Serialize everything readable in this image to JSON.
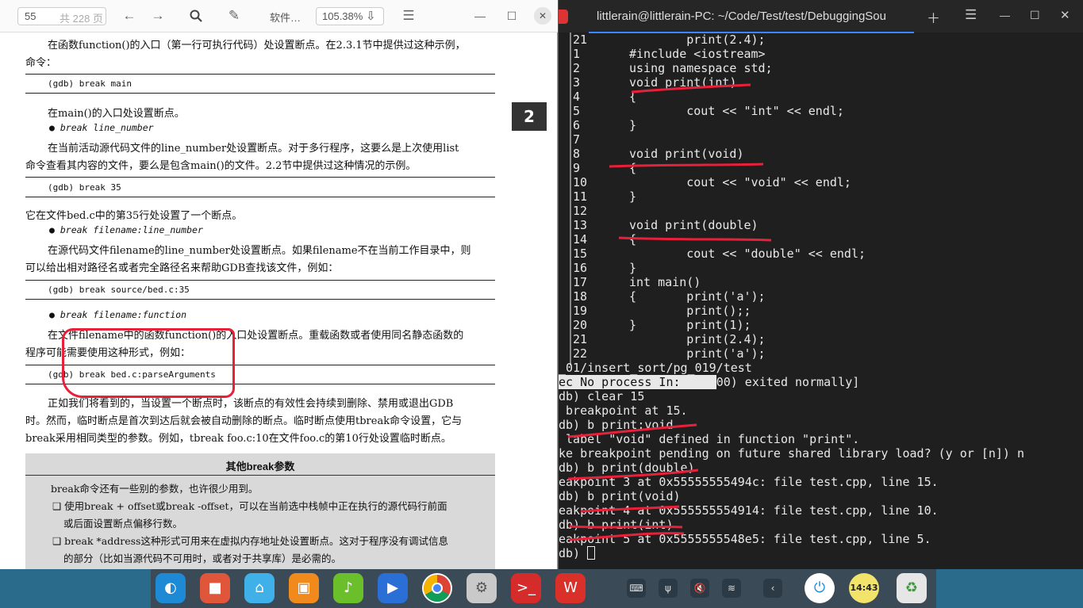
{
  "pdf": {
    "toolbar": {
      "page": "55",
      "total": "共 228 页",
      "title": "软件…",
      "zoom": "105.38%"
    },
    "chapter_tab": "2",
    "lines": [
      "在函数function()的入口（第一行可执行代码）处设置断点。在2.3.1节中提供过这种示例，",
      "命令：",
      "(gdb) break main",
      "在main()的入口处设置断点。",
      "break line_number",
      "在当前活动源代码文件的line_number处设置断点。对于多行程序，这要么是上次使用list",
      "命令查看其内容的文件，要么是包含main()的文件。2.2节中提供过这种情况的示例。",
      "(gdb) break 35",
      "它在文件bed.c中的第35行处设置了一个断点。",
      "break filename:line_number",
      "在源代码文件filename的line_number处设置断点。如果filename不在当前工作目录中，则",
      "可以给出相对路径名或者完全路径名来帮助GDB查找该文件，例如：",
      "(gdb) break source/bed.c:35",
      "break filename:function",
      "在文件filename中的函数function()的入口处设置断点。重载函数或者使用同名静态函数的",
      "程序可能需要使用这种形式，例如：",
      "(gdb) break bed.c:parseArguments",
      "正如我们将看到的，当设置一个断点时，该断点的有效性会持续到删除、禁用或退出GDB",
      "时。然而，临时断点是首次到达后就会被自动删除的断点。临时断点使用tbreak命令设置，它与",
      "break采用相同类型的参数。例如，tbreak foo.c:10在文件foo.c的第10行处设置临时断点。"
    ],
    "sidebox": {
      "title": "其他break参数",
      "lines": [
        "break命令还有一些别的参数，也许很少用到。",
        "❑ 使用break + offset或break -offset，可以在当前选中栈帧中正在执行的源代码行前面",
        "或后面设置断点偏移行数。",
        "❑ break *address这种形式可用来在虚拟内存地址处设置断点。这对于程序没有调试信息",
        "的部分（比如当源代码不可用时，或者对于共享库）是必需的。"
      ]
    }
  },
  "terminal": {
    "title": "littlerain@littlerain-PC: ~/Code/Test/test/DebuggingSou",
    "lines": [
      {
        "n": "21",
        "t": "        print(2.4);"
      },
      {
        "n": "1",
        "t": "#include <iostream>"
      },
      {
        "n": "2",
        "t": "using namespace std;"
      },
      {
        "n": "3",
        "t": "void print(int)"
      },
      {
        "n": "4",
        "t": "{"
      },
      {
        "n": "5",
        "t": "        cout << \"int\" << endl;"
      },
      {
        "n": "6",
        "t": "}"
      },
      {
        "n": "7",
        "t": ""
      },
      {
        "n": "8",
        "t": "void print(void)"
      },
      {
        "n": "9",
        "t": "{"
      },
      {
        "n": "10",
        "t": "        cout << \"void\" << endl;"
      },
      {
        "n": "11",
        "t": "}"
      },
      {
        "n": "12",
        "t": ""
      },
      {
        "n": "13",
        "t": "void print(double)"
      },
      {
        "n": "14",
        "t": "{"
      },
      {
        "n": "15",
        "t": "        cout << \"double\" << endl;"
      },
      {
        "n": "16",
        "t": "}"
      },
      {
        "n": "17",
        "t": "int main()"
      },
      {
        "n": "18",
        "t": "{       print('a');"
      },
      {
        "n": "19",
        "t": "        print();;"
      },
      {
        "n": "20",
        "t": "}       print(1);"
      },
      {
        "n": "21",
        "t": "        print(2.4);"
      },
      {
        "n": "22",
        "t": "        print('a');"
      }
    ],
    "output": [
      "_01/insert_sort/pg_019/test",
      "ec No process In:     00) exited normally]",
      "db) clear 15",
      " breakpoint at 15.",
      "db) b print:void",
      " label \"void\" defined in function \"print\".",
      "ke breakpoint pending on future shared library load? (y or [n]) n",
      "db) b print(double)",
      "eakpoint 3 at 0x55555555494c: file test.cpp, line 15.",
      "db) b print(void)",
      "eakpoint 4 at 0x555555554914: file test.cpp, line 10.",
      "db) b print(int)",
      "eakpoint 5 at 0x5555555548e5: file test.cpp, line 5.",
      "db) "
    ]
  },
  "dock": {
    "apps": [
      "launcher-icon",
      "screen-recorder-icon",
      "app-store-icon",
      "store-bag-icon",
      "music-icon",
      "video-icon",
      "chrome-icon",
      "settings-icon",
      "terminal-icon",
      "wps-icon"
    ],
    "clock": "14:43"
  }
}
